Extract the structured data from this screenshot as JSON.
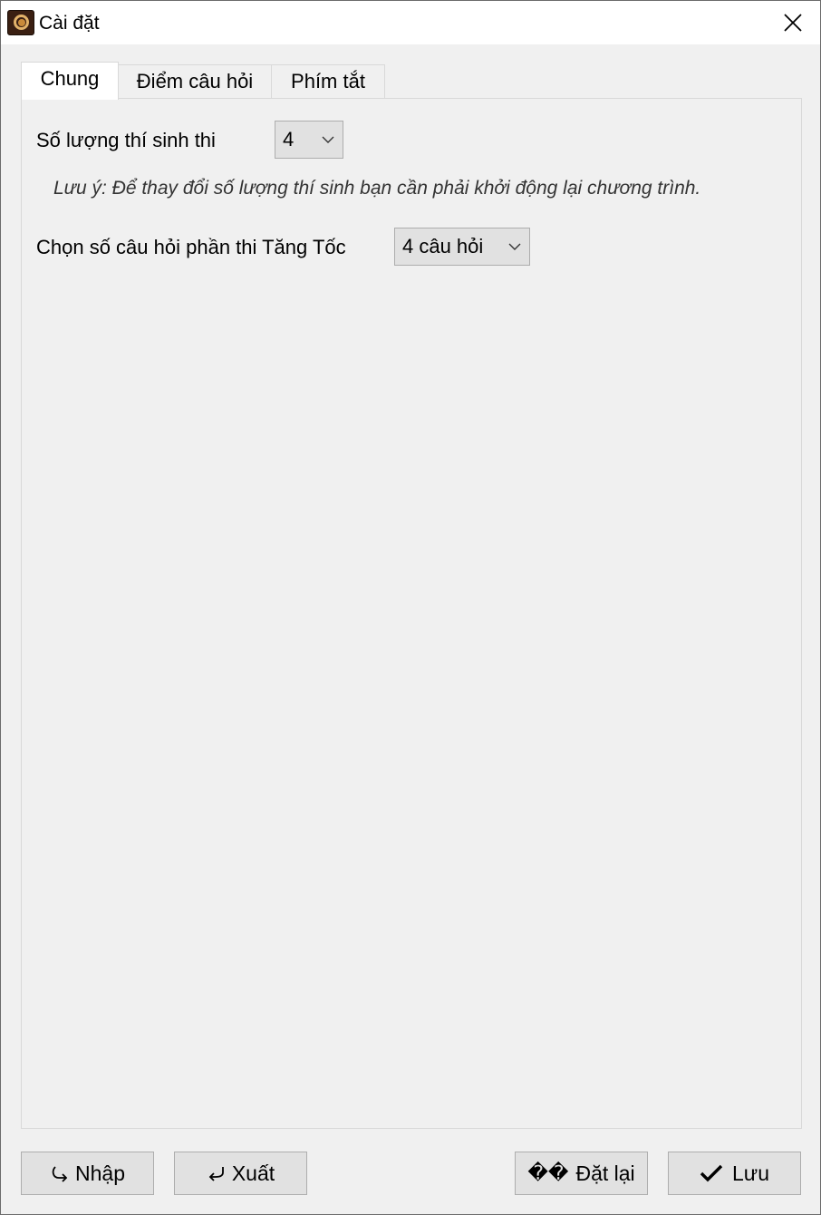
{
  "window": {
    "title": "Cài đặt"
  },
  "tabs": [
    {
      "label": "Chung",
      "active": true
    },
    {
      "label": "Điểm câu hỏi",
      "active": false
    },
    {
      "label": "Phím tắt",
      "active": false
    }
  ],
  "general": {
    "contestants_label": "Số lượng thí sinh thi",
    "contestants_value": "4",
    "note": "Lưu ý: Để thay đổi số lượng thí sinh bạn cần phải khởi động lại chương trình.",
    "speedup_label": "Chọn số câu hỏi phần thi Tăng Tốc",
    "speedup_value": "4 câu hỏi"
  },
  "buttons": {
    "import": "Nhập",
    "export": "Xuất",
    "reset_glyph": "��",
    "reset": "Đặt lại",
    "save": "Lưu"
  },
  "icons": {
    "app": "app-logo-icon",
    "close": "close-icon",
    "dropdown": "chevron-down-icon",
    "import": "import-arrow-icon",
    "export": "export-arrow-icon",
    "save": "checkmark-icon"
  }
}
